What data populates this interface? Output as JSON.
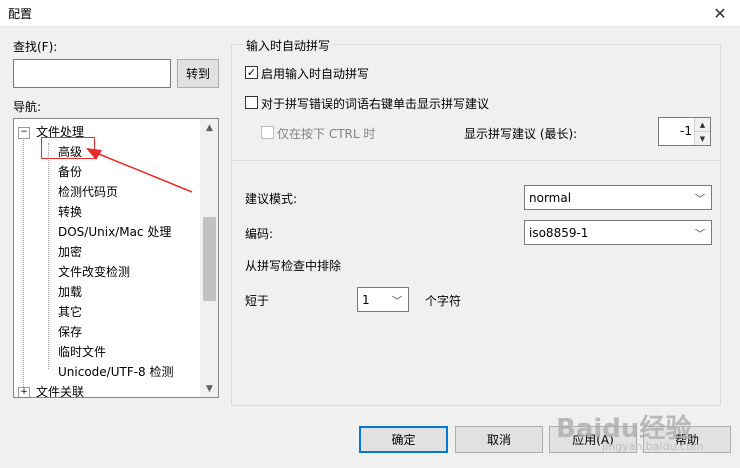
{
  "window": {
    "title": "配置",
    "close_glyph": "✕"
  },
  "search": {
    "label": "查找(F):",
    "value": "",
    "go_button": "转到"
  },
  "nav": {
    "label": "导航:",
    "items": [
      {
        "label": "文件处理",
        "toggle": "⊟"
      },
      {
        "label": "高级"
      },
      {
        "label": "备份"
      },
      {
        "label": "检测代码页"
      },
      {
        "label": "转换"
      },
      {
        "label": "DOS/Unix/Mac 处理"
      },
      {
        "label": "加密"
      },
      {
        "label": "文件改变检测"
      },
      {
        "label": "加载"
      },
      {
        "label": "其它"
      },
      {
        "label": "保存"
      },
      {
        "label": "临时文件"
      },
      {
        "label": "Unicode/UTF-8 检测"
      },
      {
        "label": "文件关联",
        "toggle": "⊞"
      }
    ],
    "scroll_up": "▲",
    "scroll_down": "▼"
  },
  "spellcheck": {
    "group_title": "输入时自动拼写",
    "enable_label": "启用输入时自动拼写",
    "enable_checked": true,
    "rightclick_label": "对于拼写错误的词语右键单击显示拼写建议",
    "rightclick_checked": false,
    "ctrl_label": "仅在按下 CTRL 时",
    "ctrl_checked": false,
    "suggest_label": "显示拼写建议 (最长):",
    "suggest_value": "-1",
    "mode_label": "建议模式:",
    "mode_value": "normal",
    "encoding_label": "编码:",
    "encoding_value": "iso8859-1",
    "exclude_label": "从拼写检查中排除",
    "shorter_label": "短于",
    "shorter_value": "1",
    "chars_label": "个字符"
  },
  "buttons": {
    "ok": "确定",
    "cancel": "取消",
    "apply": "应用(A)",
    "help": "帮助"
  },
  "watermark": {
    "text": "Baidu经验",
    "sub": "jingyan.baidu.com"
  },
  "colors": {
    "accent": "#0078d7",
    "annotation": "#e82c2c"
  }
}
